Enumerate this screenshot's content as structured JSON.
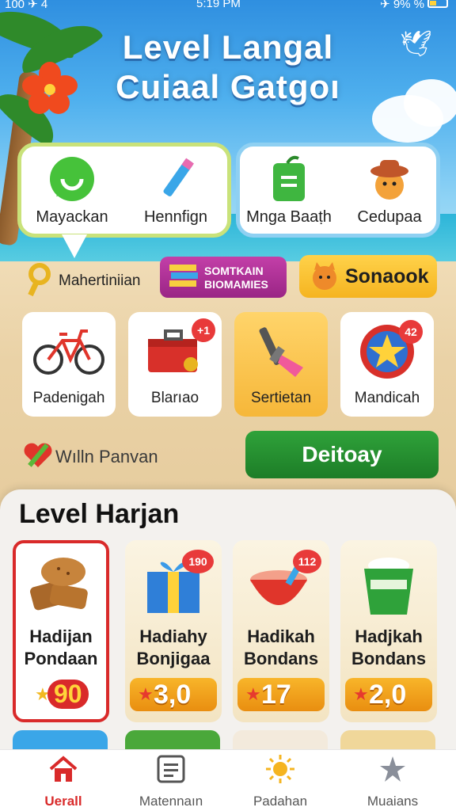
{
  "status_bar": {
    "left": "100 ✈ 4",
    "time": "5:19 PM",
    "right": "✈ 9% %"
  },
  "header": {
    "title_line1": "Level Langal",
    "title_line2": "Cuiaal Gatgoı"
  },
  "top_cards": {
    "green": [
      {
        "label": "Mayackan",
        "icon": "chat-bubble-icon"
      },
      {
        "label": "Hennfign",
        "icon": "pencil-icon"
      }
    ],
    "blue": [
      {
        "label": "Mnga Baaṭh",
        "icon": "notepad-icon"
      },
      {
        "label": "Cedupaa",
        "icon": "bear-hat-icon"
      }
    ]
  },
  "chips": {
    "key_label": "Mahertiniian",
    "purple_label_line1": "SOMTKAIN",
    "purple_label_line2": "BIOMAMIES",
    "orange_label": "Sonaook"
  },
  "tiles": [
    {
      "label": "Padenigah",
      "icon": "bicycle-icon",
      "badge": ""
    },
    {
      "label": "Blarıao",
      "icon": "toolbox-icon",
      "badge": "+1"
    },
    {
      "label": "Sertietan",
      "icon": "tools-icon",
      "badge": ""
    },
    {
      "label": "Mandicah",
      "icon": "star-coin-icon",
      "badge": "42"
    }
  ],
  "wish_label": "Wılln Panvan",
  "action_button": "Deitoay",
  "panel": {
    "title": "Level Harjan"
  },
  "cards": [
    {
      "line1": "Hadijan",
      "line2": "Pondaan",
      "price": "90",
      "badge": ""
    },
    {
      "line1": "Hadiahy",
      "line2": "Bonjigaa",
      "price": "3,0",
      "badge": "190"
    },
    {
      "line1": "Hadikah",
      "line2": "Bondans",
      "price": "17",
      "badge": "112"
    },
    {
      "line1": "Hadjkah",
      "line2": "Bondans",
      "price": "2,0",
      "badge": ""
    }
  ],
  "nav": [
    {
      "label": "Uerall",
      "icon": "house-icon",
      "active": true
    },
    {
      "label": "Matennaın",
      "icon": "list-card-icon",
      "active": false
    },
    {
      "label": "Padahan",
      "icon": "sun-icon",
      "active": false
    },
    {
      "label": "Muaians",
      "icon": "star-shuriken-icon",
      "active": false
    }
  ],
  "colors": {
    "accent_red": "#d92a2a",
    "action_green": "#1f8a2b",
    "price_orange": "#f0a020"
  }
}
